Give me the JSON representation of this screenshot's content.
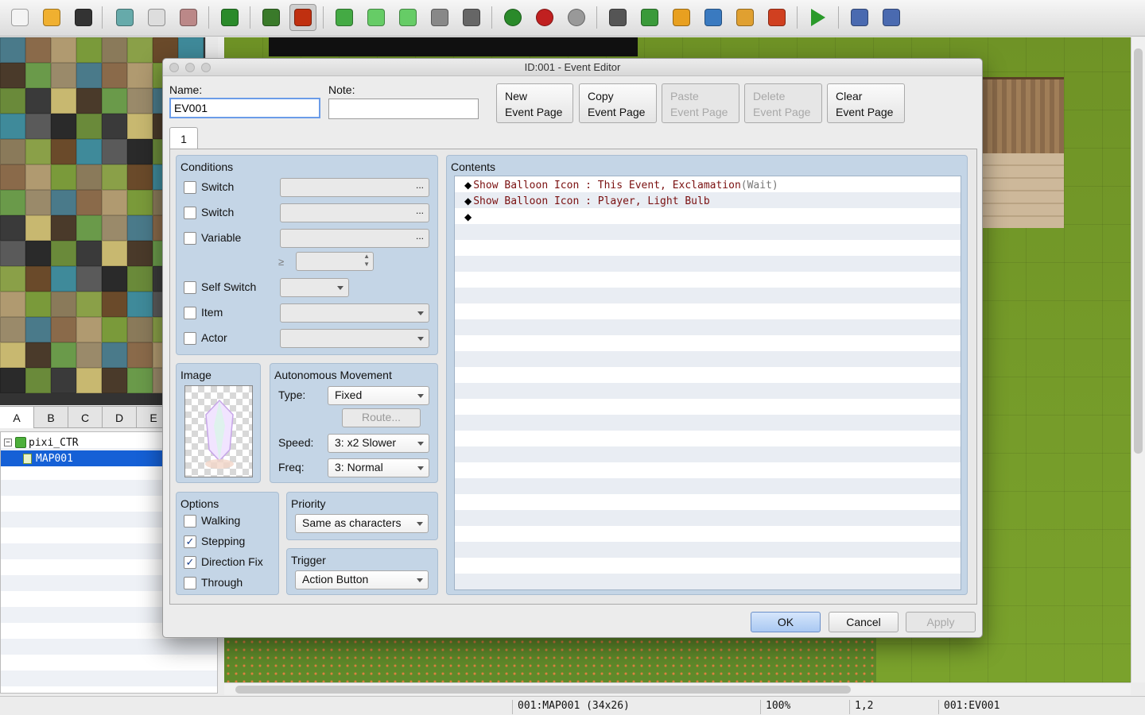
{
  "toolbar": {
    "icons": [
      "new-project-icon",
      "open-project-icon",
      "save-project-icon",
      "cut-icon",
      "copy-icon",
      "paste-icon",
      "undo-icon",
      "map-mode-icon",
      "event-mode-icon",
      "pencil-icon",
      "rectangle-icon",
      "ellipse-icon",
      "fill-icon",
      "shadow-pen-icon",
      "zoom-in-icon",
      "zoom-out-icon",
      "actual-size-icon",
      "database-icon",
      "plugin-manager-icon",
      "sound-test-icon",
      "event-searcher-icon",
      "resource-manager-icon",
      "character-generator-icon",
      "playtest-icon",
      "deployment-icon",
      "steam-icon"
    ]
  },
  "tileset_tabs": [
    "A",
    "B",
    "C",
    "D",
    "E"
  ],
  "map_tree": {
    "project": "pixi_CTR",
    "map": "MAP001"
  },
  "status_bar": {
    "map": "001:MAP001 (34x26)",
    "zoom": "100%",
    "coords": "1,2",
    "event": "001:EV001"
  },
  "dialog": {
    "title": "ID:001 - Event Editor",
    "name_label": "Name:",
    "name_value": "EV001",
    "note_label": "Note:",
    "note_value": "",
    "page_buttons": [
      {
        "line1": "New",
        "line2": "Event Page",
        "enabled": true
      },
      {
        "line1": "Copy",
        "line2": "Event Page",
        "enabled": true
      },
      {
        "line1": "Paste",
        "line2": "Event Page",
        "enabled": false
      },
      {
        "line1": "Delete",
        "line2": "Event Page",
        "enabled": false
      },
      {
        "line1": "Clear",
        "line2": "Event Page",
        "enabled": true
      }
    ],
    "page_tab": "1",
    "conditions": {
      "title": "Conditions",
      "switch1": "Switch",
      "switch2": "Switch",
      "variable": "Variable",
      "gte": "≥",
      "self_switch": "Self Switch",
      "item": "Item",
      "actor": "Actor",
      "ellipsis": "..."
    },
    "image": {
      "title": "Image"
    },
    "autonomous": {
      "title": "Autonomous Movement",
      "type_label": "Type:",
      "type_value": "Fixed",
      "route_button": "Route...",
      "speed_label": "Speed:",
      "speed_value": "3: x2 Slower",
      "freq_label": "Freq:",
      "freq_value": "3: Normal"
    },
    "options": {
      "title": "Options",
      "walking": {
        "label": "Walking",
        "checked": false
      },
      "stepping": {
        "label": "Stepping",
        "checked": true
      },
      "direction_fix": {
        "label": "Direction Fix",
        "checked": true
      },
      "through": {
        "label": "Through",
        "checked": false
      }
    },
    "priority": {
      "title": "Priority",
      "value": "Same as characters"
    },
    "trigger": {
      "title": "Trigger",
      "value": "Action Button"
    },
    "contents": {
      "title": "Contents",
      "commands": [
        {
          "bullet": "◆",
          "text": "Show Balloon Icon : This Event, Exclamation ",
          "suffix": "(Wait)"
        },
        {
          "bullet": "◆",
          "text": "Show Balloon Icon : Player, Light Bulb",
          "suffix": ""
        },
        {
          "bullet": "◆",
          "text": "",
          "suffix": ""
        }
      ]
    },
    "ok": "OK",
    "cancel": "Cancel",
    "apply": "Apply"
  },
  "colors": {
    "panel_bg": "#c4d5e6",
    "selection": "#1560d6",
    "command_text": "#7a1010"
  }
}
